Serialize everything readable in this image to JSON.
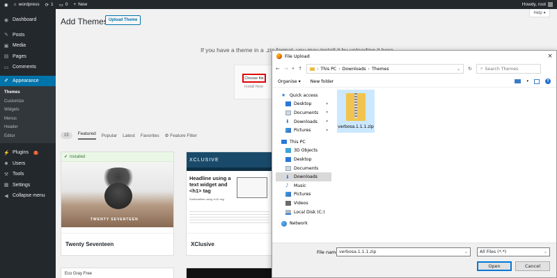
{
  "adminbar": {
    "site_name": "wordpress",
    "updates_count": "1",
    "comments_count": "0",
    "new_label": "New",
    "howdy": "Howdy, root"
  },
  "sidebar": {
    "items": [
      {
        "label": "Dashboard",
        "icon": "dashboard-icon"
      },
      {
        "label": "Posts",
        "icon": "pin-icon"
      },
      {
        "label": "Media",
        "icon": "media-icon"
      },
      {
        "label": "Pages",
        "icon": "page-icon"
      },
      {
        "label": "Comments",
        "icon": "comment-icon"
      },
      {
        "label": "Appearance",
        "icon": "brush-icon"
      },
      {
        "label": "Plugins",
        "icon": "plugin-icon",
        "badge": "1"
      },
      {
        "label": "Users",
        "icon": "user-icon"
      },
      {
        "label": "Tools",
        "icon": "wrench-icon"
      },
      {
        "label": "Settings",
        "icon": "settings-icon"
      },
      {
        "label": "Collapse menu",
        "icon": "collapse-icon"
      }
    ],
    "submenu": [
      "Themes",
      "Customize",
      "Widgets",
      "Menus",
      "Header",
      "Editor"
    ]
  },
  "main": {
    "title": "Add Themes",
    "upload_button": "Upload Theme",
    "help_button": "Help",
    "upload_message": "If you have a theme in a .zip format, you may install it by uploading it here.",
    "choose_file": "Choose file",
    "install_now": "Install Now",
    "filter": {
      "count": "15",
      "links": [
        "Featured",
        "Popular",
        "Latest",
        "Favorites"
      ],
      "feature_filter": "Feature Filter"
    },
    "themes": [
      {
        "name": "Twenty Seventeen",
        "installed_label": "Installed",
        "screenshot_text": "TWENTY SEVENTEEN"
      },
      {
        "name": "XClusive",
        "logo": "XCLUSIVE",
        "headline": "Headline using a text widget and <h1> tag",
        "sub": "Subheadline using <h3> tag"
      },
      {
        "name": "Eco Gray Free"
      },
      {
        "name": ""
      }
    ]
  },
  "dialog": {
    "title": "File Upload",
    "close": "×",
    "breadcrumb": [
      "This PC",
      "Downloads",
      "Themes"
    ],
    "search_placeholder": "Search Themes",
    "organise": "Organise",
    "new_folder": "New folder",
    "nav": {
      "quick_access": "Quick access",
      "quick": [
        "Desktop",
        "Documents",
        "Downloads",
        "Pictures"
      ],
      "this_pc": "This PC",
      "pc": [
        "3D Objects",
        "Desktop",
        "Documents",
        "Downloads",
        "Music",
        "Pictures",
        "Videos",
        "Local Disk (C:)"
      ],
      "network": "Network"
    },
    "file": {
      "name": "verbosa.1.1.1.zip"
    },
    "file_name_label": "File name:",
    "file_name_value": "verbosa.1.1.1.zip",
    "file_type": "All Files (*.*)",
    "open": "Open",
    "cancel": "Cancel"
  }
}
